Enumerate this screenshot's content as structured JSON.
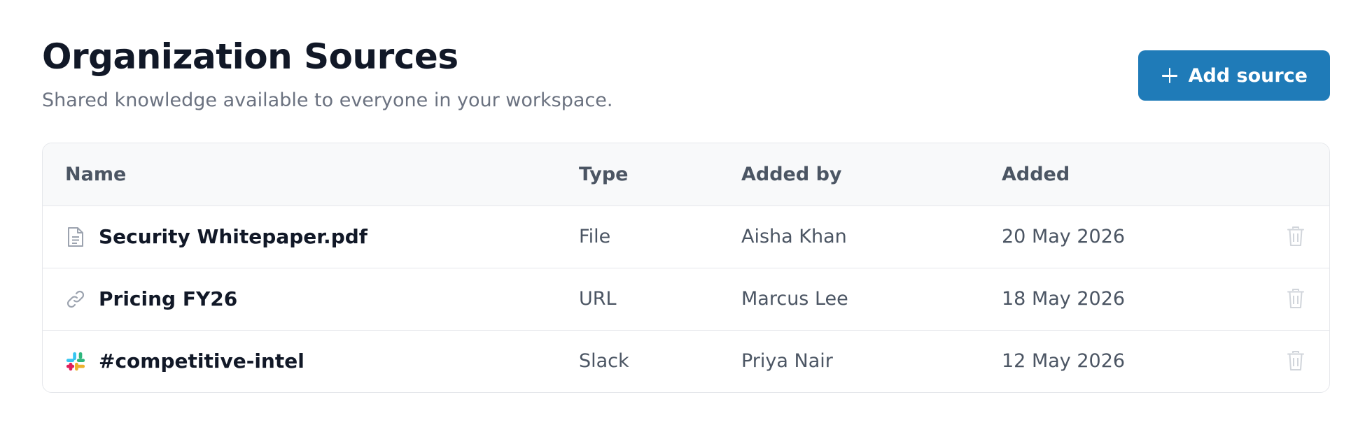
{
  "header": {
    "title": "Organization Sources",
    "subtitle": "Shared knowledge available to everyone in your workspace.",
    "add_button_label": "Add source"
  },
  "table": {
    "columns": [
      "Name",
      "Type",
      "Added by",
      "Added"
    ],
    "rows": [
      {
        "name": "Security Whitepaper.pdf",
        "type": "File",
        "added_by": "Aisha Khan",
        "added": "20 May 2026",
        "icon": "file-icon"
      },
      {
        "name": "Pricing FY26",
        "type": "URL",
        "added_by": "Marcus Lee",
        "added": "18 May 2026",
        "icon": "link-icon"
      },
      {
        "name": "#competitive-intel",
        "type": "Slack",
        "added_by": "Priya Nair",
        "added": "12 May 2026",
        "icon": "slack-icon"
      }
    ]
  },
  "colors": {
    "accent": "#1f7bb8",
    "title": "#111827",
    "muted": "#6b7280",
    "border": "#e5e7eb",
    "header_bg": "#f8f9fa",
    "trash": "#d1d5db"
  }
}
